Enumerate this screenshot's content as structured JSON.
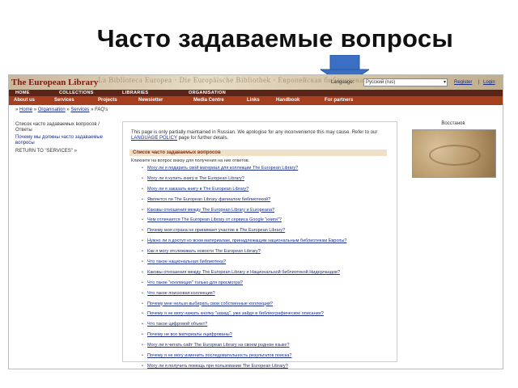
{
  "slide": {
    "title": "Часто задаваемые вопросы"
  },
  "site": {
    "logo": "The European Library",
    "banner_ghost_text": "La Biblioteca Europea · Die Europäische Bibliothek · Европейская библиотека",
    "language_label": "Language:",
    "language_value": "Русский (rus)",
    "register": "Register",
    "separator": "|",
    "login": "Login"
  },
  "category_bar": [
    "HOME",
    "COLLECTIONS",
    "LIBRARIES",
    "ORGANISATION"
  ],
  "nav": [
    "About us",
    "Services",
    "Projects",
    "Newsletter",
    "Media Centre",
    "Links",
    "Handbook",
    "For partners"
  ],
  "breadcrumb": {
    "prefix": "» ",
    "home": "Home",
    "sep": " » ",
    "organisation": "Organisation",
    "services": "Services",
    "current": "FAQ's"
  },
  "sidebar": {
    "heading": "Список часто задаваемых вопросов / Ответы",
    "link": "Почему мы должны часто задаваемые вопросы",
    "back": "RETURN TO \"SERVICES\" »"
  },
  "content": {
    "intro": "This page is only partially maintained in Russian. We apologise for any inconvenience this may cause. Refer to our",
    "intro_link": "LANGUAGE POLICY",
    "intro_end": "page for further details.",
    "list_heading": "Список часто задаваемых вопросов",
    "list_note": "Кликните на вопрос внизу для получения на них ответов.",
    "faq": [
      "Могу ли я подарить свой материал для коллекции The European Library?",
      "Могу ли я купить книгу в The European Library?",
      "Могу ли я заказать книгу в The European Library?",
      "Является ли The European Library филиалом библиотекой?",
      "Каковы отношения между The European Library и Europeana?",
      "Чем отличается The European Library от сервиса Google \"книги\"?",
      "Почему моя страна не принимает участие в The European Library?",
      "Нужно ли я доступ ко всем материалам, принадлежащим национальным библиотекам Европы?",
      "Как я могу отслеживать новости The European Library?",
      "Что такое национальная библиотека?",
      "Каковы отношения между The European Library и Национальной библиотекой Нидерландов?",
      "Что такое \"коллекция\" только для просмотра?",
      "Что такое поисковая коллекция?",
      "Почему мне нельзя выбирать свои собственные коллекции?",
      "Почему я не могу нажать кнопку \"назад\", уже зайдя в библиографическое описание?",
      "Что такое цифровой объект?",
      "Почему не все материалы оцифрованы?",
      "Могу ли я читать сайт The European Library на своем родном языке?",
      "Почему я не могу изменить последовательность результатов поиска?",
      "Могу ли я получить помощь при пользовании The European Library?"
    ]
  },
  "right_panel": {
    "title": "Восстанов"
  },
  "colors": {
    "nav_bg": "#a53f1e",
    "category_bg": "#5a2418",
    "link": "#1a2f8a",
    "arrow": "#3a6fc4"
  },
  "icons": {
    "arrow": "down-arrow-icon",
    "select_caret": "chevron-down-icon"
  }
}
